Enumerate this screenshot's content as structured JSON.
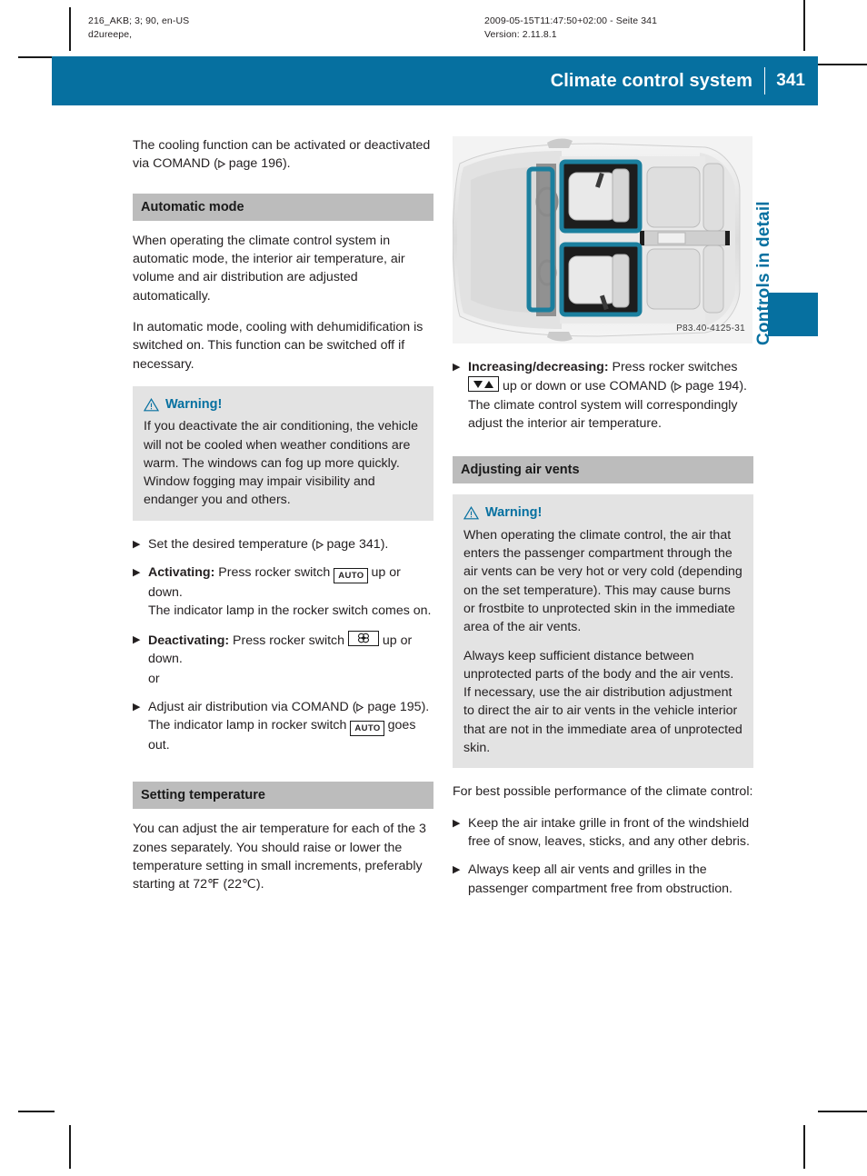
{
  "slug": {
    "left_line1": "216_AKB; 3; 90, en-US",
    "left_line2": "d2ureepe,",
    "right_line1": "2009-05-15T11:47:50+02:00 - Seite 341",
    "right_line2": "Version: 2.11.8.1"
  },
  "header": {
    "title": "Climate control system",
    "page_number": "341",
    "band_color": "#0670a0"
  },
  "side_tab": {
    "label": "Controls in detail",
    "color": "#0670a0"
  },
  "left_column": {
    "intro": "The cooling function can be activated or deactivated via COMAND (",
    "intro_ref": "page 196",
    "intro_end": ").",
    "section_automatic": {
      "heading": "Automatic mode",
      "paragraph_1": "When operating the climate control system in automatic mode, the interior air temperature, air volume and air distribution are adjusted automatically.",
      "paragraph_2": "In automatic mode, cooling with dehumidification is switched on. This function can be switched off if necessary.",
      "warning": {
        "title": "Warning!",
        "text": "If you deactivate the air conditioning, the vehicle will not be cooled when weather conditions are warm. The windows can fog up more quickly. Window fogging may impair visibility and endanger you and others."
      },
      "steps": [
        {
          "lead": "",
          "text": "Set the desired temperature (",
          "ref": "page 341",
          "text_after": ").",
          "sub": ""
        },
        {
          "lead": "Activating:",
          "text": " Press rocker switch ",
          "icon": "auto-rocker-switch-icon",
          "text_after": " up or down.",
          "sub": "The indicator lamp in the rocker switch comes on."
        },
        {
          "lead": "Deactivating:",
          "text": " Press rocker switch ",
          "icon": "blower-fan-icon",
          "text_after": " up or down.",
          "sub": ""
        }
      ],
      "or_label": "or",
      "step_comand": {
        "text": "Adjust air distribution via COMAND (",
        "ref": "page 195",
        "text_after": ").",
        "sub_before": "The indicator lamp in rocker switch ",
        "icon": "auto-rocker-switch-icon",
        "sub_after": " goes out."
      }
    },
    "section_temperature": {
      "heading": "Setting temperature",
      "paragraph": "You can adjust the air temperature for each of the 3 zones separately. You should raise or lower the temperature setting in small increments, preferably starting at 72℉ (22℃)."
    }
  },
  "right_column": {
    "figure": {
      "name": "vehicle-interior-top-view",
      "caption_code": "P83.40-4125-31",
      "highlight_color": "#1b7f9e"
    },
    "step_increase": {
      "lead": "Increasing/decreasing:",
      "text": " Press rocker switches ",
      "icon": "up-down-rocker-switch-icon",
      "text_after": " up or down or use COMAND (",
      "ref": "page 194",
      "text_end": ").",
      "sub": "The climate control system will correspondingly adjust the interior air temperature."
    },
    "section_vents": {
      "heading": "Adjusting air vents",
      "warning": {
        "title": "Warning!",
        "paragraph_1": "When operating the climate control, the air that enters the passenger compartment through the air vents can be very hot or very cold (depending on the set temperature). This may cause burns or frostbite to unprotected skin in the immediate area of the air vents.",
        "paragraph_2": "Always keep sufficient distance between unprotected parts of the body and the air vents. If necessary, use the air distribution adjustment to direct the air to air vents in the vehicle interior that are not in the immediate area of unprotected skin."
      },
      "lead_in": "For best possible performance of the climate control:",
      "bullets": [
        "Keep the air intake grille in front of the windshield free of snow, leaves, sticks, and any other debris.",
        "Always keep all air vents and grilles in the passenger compartment free from obstruction."
      ]
    }
  }
}
